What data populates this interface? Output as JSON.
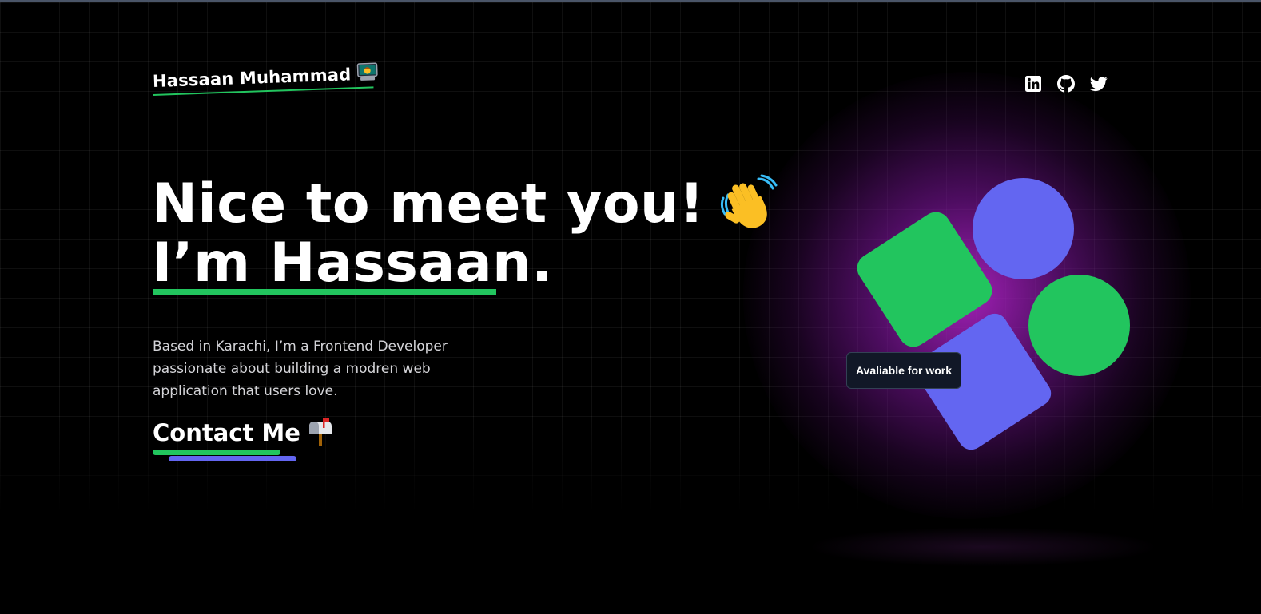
{
  "header": {
    "brand_name": "Hassaan Muhammad",
    "brand_emoji_icon": "technologist-emoji-icon",
    "socials": [
      {
        "label": "LinkedIn",
        "icon": "linkedin-icon"
      },
      {
        "label": "GitHub",
        "icon": "github-icon"
      },
      {
        "label": "Twitter",
        "icon": "twitter-icon"
      }
    ]
  },
  "hero": {
    "headline_line1": "Nice to meet you!",
    "headline_line2": "I’m Hassaan.",
    "wave_icon": "waving-hand-icon",
    "intro": "Based in Karachi, I’m a Frontend Developer passionate about building a modren web application that users love.",
    "contact_label": "Contact Me",
    "contact_icon": "mailbox-icon"
  },
  "showcase": {
    "badge_text": "Avaliable for work"
  },
  "colors": {
    "background": "#000000",
    "accent_green": "#22c55e",
    "accent_indigo": "#6366f1",
    "glow_purple": "#a822be",
    "badge_bg": "#111827"
  }
}
